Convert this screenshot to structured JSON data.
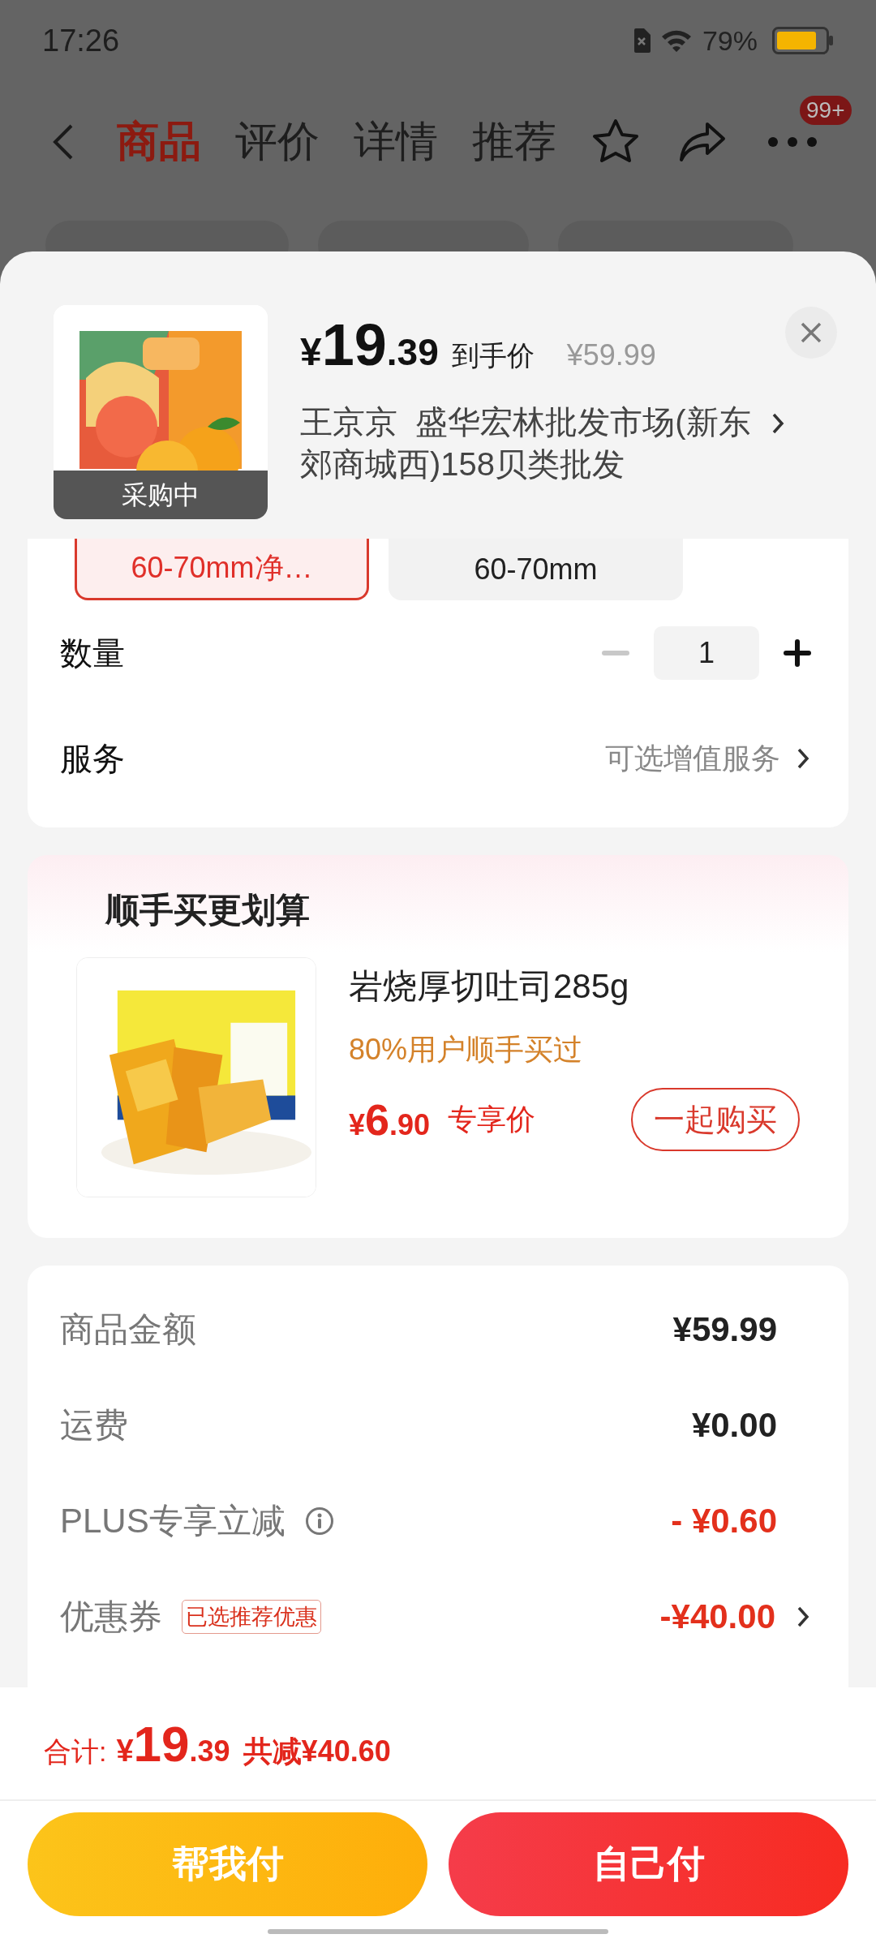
{
  "status_bar": {
    "time": "17:26",
    "battery": "79%"
  },
  "nav": {
    "tabs": [
      {
        "label": "商品",
        "selected": true
      },
      {
        "label": "评价",
        "selected": false
      },
      {
        "label": "详情",
        "selected": false
      },
      {
        "label": "推荐",
        "selected": false
      }
    ],
    "badge": "99+"
  },
  "product": {
    "currency": "¥",
    "price_int": "19",
    "price_dec": ".39",
    "price_label": "到手价",
    "original_price": "¥59.99",
    "seller": "王京京  盛华宏林批发市场(新东郊商城西)158贝类批发",
    "image_badge": "采购中"
  },
  "variants": [
    {
      "label": "60-70mm净…",
      "selected": true
    },
    {
      "label": "60-70mm",
      "selected": false
    }
  ],
  "quantity": {
    "label": "数量",
    "value": "1",
    "decrease_disabled": true
  },
  "service": {
    "label": "服务",
    "value": "可选增值服务"
  },
  "bundle": {
    "title": "顺手买更划算",
    "name": "岩烧厚切吐司285g",
    "note": "80%用户顺手买过",
    "currency": "¥",
    "price_int": "6",
    "price_dec": ".90",
    "price_label": "专享价",
    "button": "一起购买"
  },
  "summary": [
    {
      "label": "商品金额",
      "value": "¥59.99",
      "kind": "plain"
    },
    {
      "label": "运费",
      "value": "¥0.00",
      "kind": "plain"
    },
    {
      "label": "PLUS专享立减",
      "value": "- ¥0.60",
      "kind": "discount",
      "info": true
    },
    {
      "label": "优惠券",
      "value": "-¥40.00",
      "kind": "discount",
      "tag": "已选推荐优惠",
      "arrow": true
    }
  ],
  "total": {
    "label": "合计:",
    "currency": "¥",
    "price_int": "19",
    "price_dec": ".39",
    "saved": "共减¥40.60"
  },
  "buttons": [
    {
      "label": "帮我付",
      "kind": "secondary"
    },
    {
      "label": "自己付",
      "kind": "primary"
    }
  ]
}
